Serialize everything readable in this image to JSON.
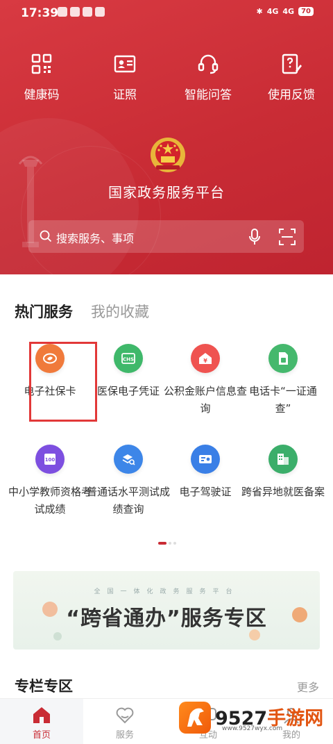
{
  "status_bar": {
    "time": "17:39",
    "network_left": "4G",
    "network_right": "4G",
    "battery": "70"
  },
  "quick_actions": [
    {
      "label": "健康码",
      "icon": "qr-code-icon"
    },
    {
      "label": "证照",
      "icon": "id-card-icon"
    },
    {
      "label": "智能问答",
      "icon": "headset-icon"
    },
    {
      "label": "使用反馈",
      "icon": "feedback-icon"
    }
  ],
  "platform_title": "国家政务服务平台",
  "search": {
    "placeholder": "搜索服务、事项",
    "voice_icon": "microphone-icon",
    "scan_icon": "scan-icon"
  },
  "tabs": {
    "hot": "热门服务",
    "favorites": "我的收藏"
  },
  "services": [
    {
      "label": "电子社保卡",
      "icon": "social-security-icon",
      "color": "#f07a3b"
    },
    {
      "label": "医保电子凭证",
      "icon": "chs-icon",
      "color": "#3fb86a"
    },
    {
      "label": "公积金账户信息查询",
      "icon": "housing-fund-icon",
      "color": "#ef5350"
    },
    {
      "label": "电话卡“一证通查”",
      "icon": "sim-card-icon",
      "color": "#45b86d"
    },
    {
      "label": "中小学教师资格考试成绩",
      "icon": "score-icon",
      "color": "#7d4fe0"
    },
    {
      "label": "普通话水平测试成绩查询",
      "icon": "test-search-icon",
      "color": "#3d86e8"
    },
    {
      "label": "电子驾驶证",
      "icon": "driver-license-icon",
      "color": "#3a7fe6"
    },
    {
      "label": "跨省异地就医备案",
      "icon": "medical-record-icon",
      "color": "#3bae6a"
    }
  ],
  "banner": {
    "subtitle": "全国一体化政务服务平台",
    "title": "“跨省通办”服务专区"
  },
  "section": {
    "title": "专栏专区",
    "more": "更多"
  },
  "tab_bar": [
    {
      "label": "首页",
      "icon": "home-icon"
    },
    {
      "label": "服务",
      "icon": "service-icon"
    },
    {
      "label": "互动",
      "icon": "chat-icon"
    },
    {
      "label": "我的",
      "icon": "profile-icon"
    }
  ],
  "watermark": {
    "brand_number": "9527",
    "brand_text": "手游网",
    "url": "www.9527wyx.com"
  },
  "colors": {
    "brand_red": "#c92c35",
    "selection_box": "#e23838"
  }
}
